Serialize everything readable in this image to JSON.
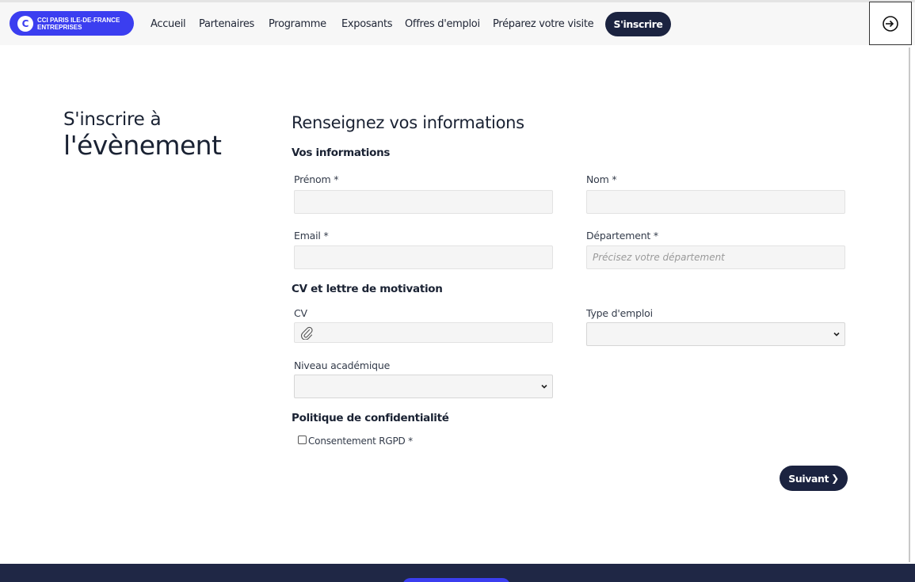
{
  "header": {
    "logo": {
      "line1": "CCI PARIS ILE-DE-FRANCE",
      "line2": "ENTREPRISES",
      "mark": "C"
    },
    "nav": [
      {
        "label": "Accueil"
      },
      {
        "label": "Partenaires"
      },
      {
        "label": "Programme"
      },
      {
        "label": "Exposants"
      },
      {
        "label": "Offres d'emploi"
      },
      {
        "label": "Préparez votre visite"
      }
    ],
    "signup_label": "S'inscrire",
    "login_icon": "login-icon"
  },
  "left": {
    "title_line1": "S'inscrire à",
    "title_line2": "l'évènement"
  },
  "form": {
    "title": "Renseignez vos informations",
    "section_info": "Vos informations",
    "first_name": {
      "label": "Prénom *",
      "value": "",
      "placeholder": ""
    },
    "last_name": {
      "label": "Nom *",
      "value": "",
      "placeholder": ""
    },
    "email": {
      "label": "Email *",
      "value": "",
      "placeholder": ""
    },
    "department": {
      "label": "Département *",
      "value": "",
      "placeholder": "Précisez votre département"
    },
    "section_cv": "CV et lettre de motivation",
    "cv": {
      "label": "CV",
      "icon": "paperclip-icon"
    },
    "job_type": {
      "label": "Type d'emploi",
      "selected": ""
    },
    "academic_level": {
      "label": "Niveau académique",
      "selected": ""
    },
    "section_privacy": "Politique de confidentialité",
    "consent": {
      "label": "Consentement RGPD *",
      "checked": false
    },
    "next_label": "Suivant"
  },
  "colors": {
    "brand_blue": "#3b3ef0",
    "navy": "#1b2340",
    "footer": "#1f2745"
  }
}
